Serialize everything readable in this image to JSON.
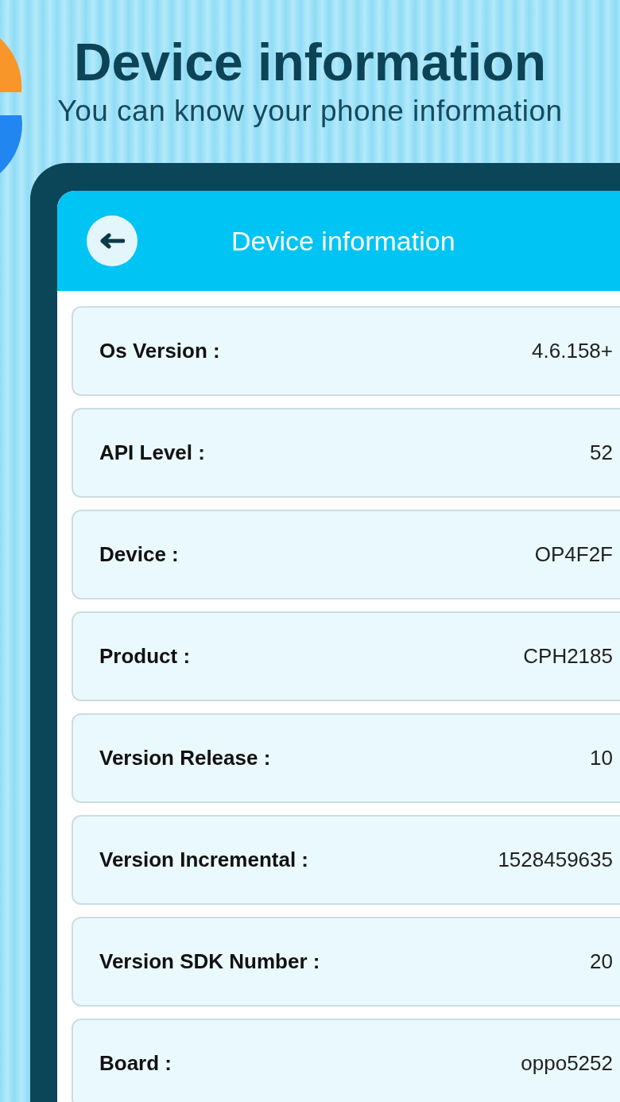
{
  "promo": {
    "title": "Device information",
    "subtitle": "You can know your phone information"
  },
  "app_bar": {
    "title": "Device information"
  },
  "rows": [
    {
      "label": "Os Version :",
      "value": "4.6.158+"
    },
    {
      "label": "API Level :",
      "value": "52"
    },
    {
      "label": "Device :",
      "value": "OP4F2F"
    },
    {
      "label": "Product :",
      "value": "CPH2185"
    },
    {
      "label": "Version Release :",
      "value": "10"
    },
    {
      "label": "Version Incremental :",
      "value": "1528459635"
    },
    {
      "label": "Version SDK Number :",
      "value": "20"
    },
    {
      "label": "Board :",
      "value": "oppo5252"
    }
  ]
}
